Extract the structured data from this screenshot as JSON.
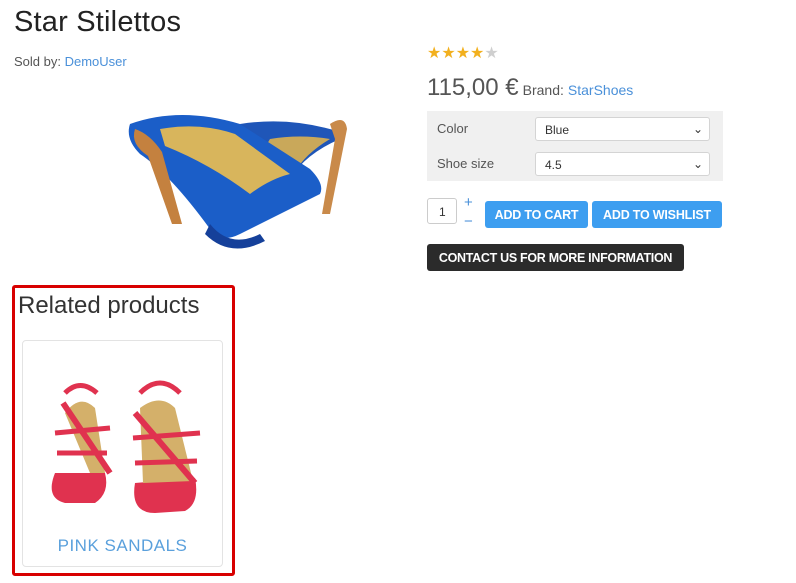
{
  "product": {
    "title": "Star Stilettos",
    "sold_by_label": "Sold by:",
    "seller": "DemoUser",
    "rating": {
      "value": 4,
      "max": 5,
      "filled_color": "#f2b01e",
      "empty_color": "#cfcfcf"
    },
    "price": "115,00 €",
    "brand_label": "Brand:",
    "brand": "StarShoes",
    "image_icon": "blue-stiletto-shoes-image"
  },
  "options": {
    "color": {
      "label": "Color",
      "value": "Blue"
    },
    "shoe_size": {
      "label": "Shoe size",
      "value": "4.5"
    }
  },
  "quantity": {
    "value": "1",
    "plus": "+",
    "minus": "−"
  },
  "buttons": {
    "add_to_cart": "ADD TO CART",
    "add_to_wishlist": "ADD TO WISHLIST",
    "contact": "CONTACT US FOR MORE INFORMATION"
  },
  "related": {
    "title": "Related products",
    "items": [
      {
        "name": "PINK SANDALS",
        "image_icon": "pink-sandals-image"
      }
    ]
  },
  "colors": {
    "accent_blue": "#3d9ef0",
    "link_blue": "#4a90d9",
    "dark_button": "#2b2b2b",
    "highlight_red": "#d80000"
  }
}
